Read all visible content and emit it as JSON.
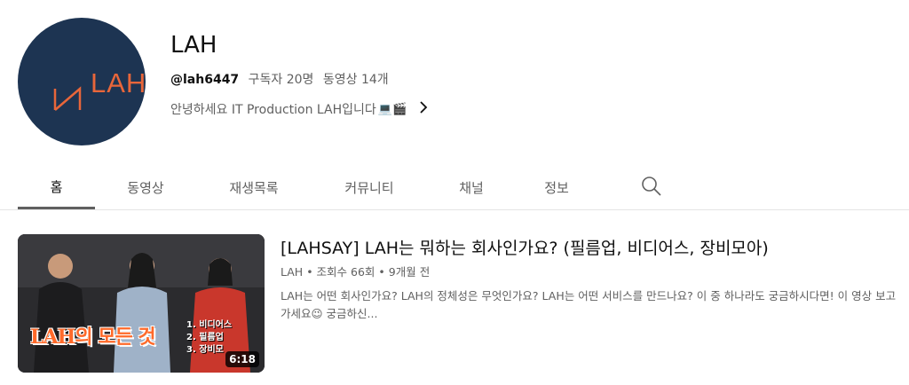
{
  "channel": {
    "logo_text": "LAH",
    "name": "LAH",
    "handle": "@lah6447",
    "subscribers": "구독자 20명",
    "videos": "동영상 14개",
    "description": "안녕하세요 IT Production LAH입니다",
    "description_emoji": "💻🎬"
  },
  "tabs": [
    {
      "label": "홈",
      "active": true
    },
    {
      "label": "동영상",
      "active": false
    },
    {
      "label": "재생목록",
      "active": false
    },
    {
      "label": "커뮤니티",
      "active": false
    },
    {
      "label": "채널",
      "active": false
    },
    {
      "label": "정보",
      "active": false
    }
  ],
  "featured_video": {
    "thumbnail_title": "LAH의 모든 것",
    "thumbnail_items": [
      "1. 비디어스",
      "2. 필름업",
      "3. 장비모"
    ],
    "duration": "6:18",
    "title": "[LAHSAY] LAH는 뭐하는 회사인가요? (필름업, 비디어스, 장비모아)",
    "channel": "LAH",
    "views": "조회수 66회",
    "age": "9개월 전",
    "description": "LAH는 어떤 회사인가요? LAH의 정체성은 무엇인가요? LAH는 어떤 서비스를 만드나요? 이 중 하나라도 궁금하시다면! 이 영상 보고가세요😉 궁금하신..."
  },
  "colors": {
    "avatar_bg": "#1d3452",
    "logo_accent": "#e8663a",
    "thumbnail_title": "#ff6a2a"
  }
}
